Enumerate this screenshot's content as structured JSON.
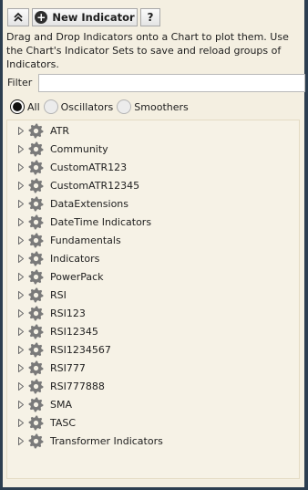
{
  "toolbar": {
    "collapse_icon": "double-chevron-up-icon",
    "new_indicator_icon": "plus-circle-icon",
    "new_indicator_label": "New Indicator",
    "help_label": "?"
  },
  "description": "Drag and Drop Indicators onto a Chart to plot them. Use the Chart's Indicator Sets to save and reload groups of Indicators.",
  "filter": {
    "label": "Filter",
    "value": "",
    "placeholder": ""
  },
  "radios": [
    {
      "label": "All",
      "selected": true
    },
    {
      "label": "Oscillators",
      "selected": false
    },
    {
      "label": "Smoothers",
      "selected": false
    }
  ],
  "tree": {
    "expander_icon": "triangle-right-icon",
    "item_icon": "gear-icon",
    "items": [
      "ATR",
      "Community",
      "CustomATR123",
      "CustomATR12345",
      "DataExtensions",
      "DateTime Indicators",
      "Fundamentals",
      "Indicators",
      "PowerPack",
      "RSI",
      "RSI123",
      "RSI12345",
      "RSI1234567",
      "RSI777",
      "RSI777888",
      "SMA",
      "TASC",
      "Transformer Indicators"
    ]
  },
  "colors": {
    "panel_background": "#f4efe1",
    "frame_border": "#2c3e50",
    "text": "#1e1e1e",
    "gear": "#7a7a7a"
  }
}
